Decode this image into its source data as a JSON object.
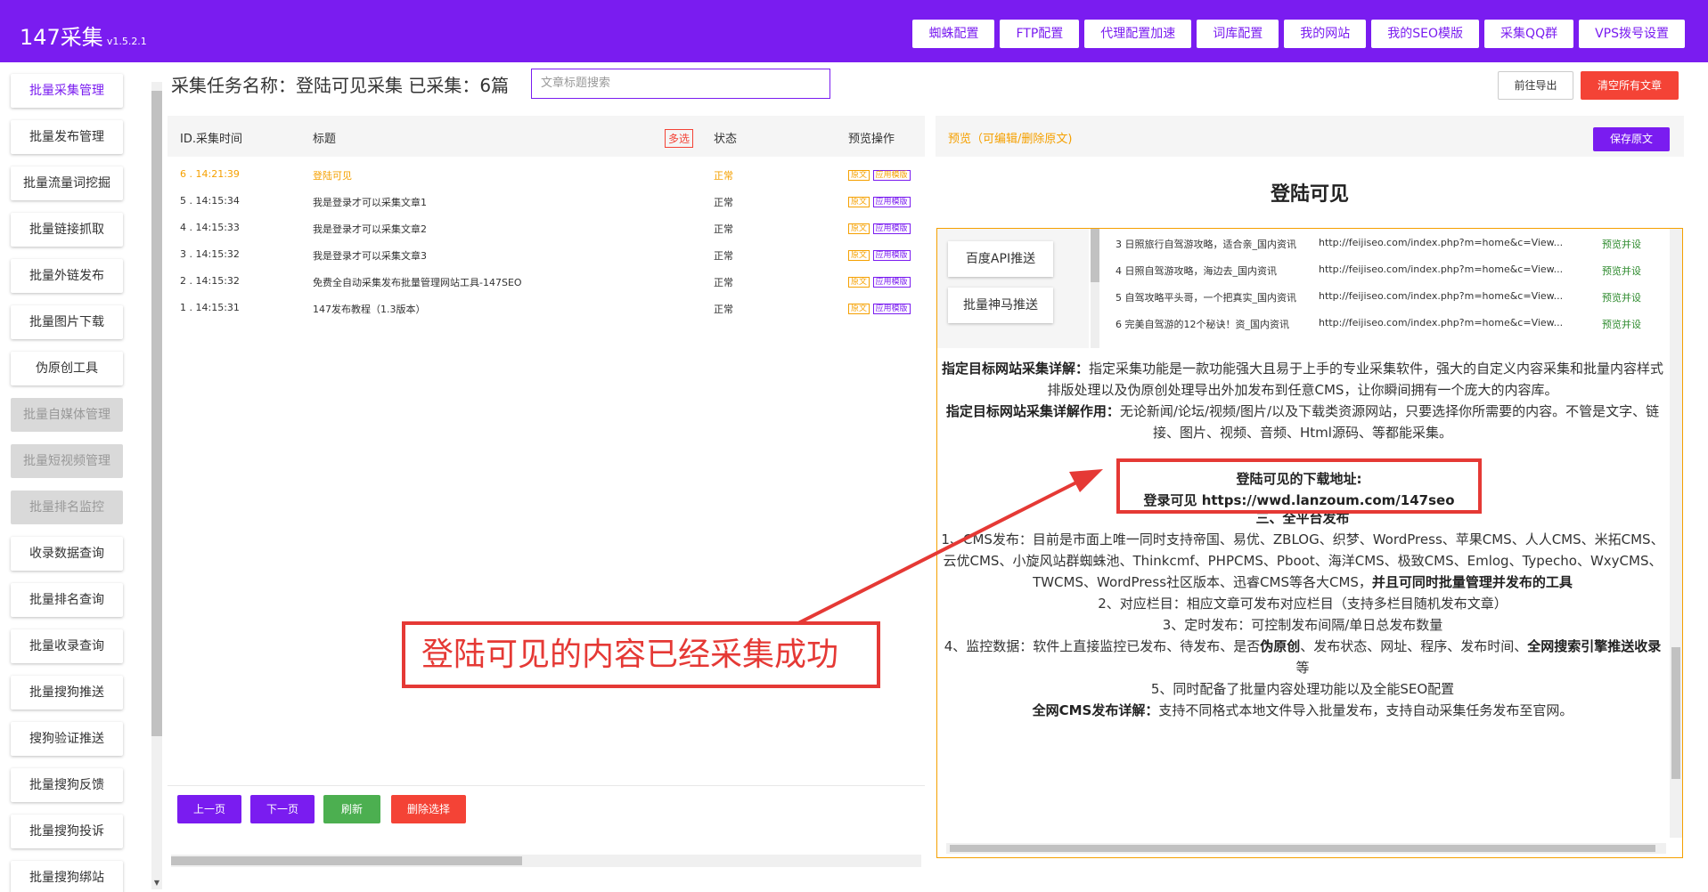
{
  "app": {
    "name": "147采集",
    "version": "v1.5.2.1"
  },
  "colors": {
    "brand": "#7a1cf0",
    "danger": "#f44336",
    "warn": "#f5a000",
    "success": "#4caf50",
    "annotation": "#e53935"
  },
  "topnav": [
    "蜘蛛配置",
    "FTP配置",
    "代理配置加速",
    "词库配置",
    "我的网站",
    "我的SEO模版",
    "采集QQ群",
    "VPS拨号设置"
  ],
  "sidebar": {
    "items": [
      {
        "label": "批量采集管理",
        "state": "active"
      },
      {
        "label": "批量发布管理",
        "state": "normal"
      },
      {
        "label": "批量流量词挖掘",
        "state": "normal"
      },
      {
        "label": "批量链接抓取",
        "state": "normal"
      },
      {
        "label": "批量外链发布",
        "state": "normal"
      },
      {
        "label": "批量图片下载",
        "state": "normal"
      },
      {
        "label": "伪原创工具",
        "state": "normal"
      },
      {
        "label": "批量自媒体管理",
        "state": "disabled"
      },
      {
        "label": "批量短视频管理",
        "state": "disabled"
      },
      {
        "label": "批量排名监控",
        "state": "disabled"
      },
      {
        "label": "收录数据查询",
        "state": "normal"
      },
      {
        "label": "批量排名查询",
        "state": "normal"
      },
      {
        "label": "批量收录查询",
        "state": "normal"
      },
      {
        "label": "批量搜狗推送",
        "state": "normal"
      },
      {
        "label": "搜狗验证推送",
        "state": "normal"
      },
      {
        "label": "批量搜狗反馈",
        "state": "normal"
      },
      {
        "label": "批量搜狗投诉",
        "state": "normal"
      },
      {
        "label": "批量搜狗绑站",
        "state": "normal"
      }
    ]
  },
  "task": {
    "title": "采集任务名称：登陆可见采集 已采集：6篇",
    "search_placeholder": "文章标题搜索",
    "export_label": "前往导出",
    "clear_label": "清空所有文章"
  },
  "list": {
    "headers": {
      "id_time": "ID.采集时间",
      "title": "标题",
      "multi": "多选",
      "status": "状态",
      "actions": "预览操作"
    },
    "rows": [
      {
        "id_time": "6 . 14:21:39",
        "title": "登陆可见",
        "status": "正常",
        "tag1": "原文",
        "tag2": "应用模版",
        "highlight": true
      },
      {
        "id_time": "5 . 14:15:34",
        "title": "我是登录才可以采集文章1",
        "status": "正常",
        "tag1": "原文",
        "tag2": "应用模版",
        "highlight": false
      },
      {
        "id_time": "4 . 14:15:33",
        "title": "我是登录才可以采集文章2",
        "status": "正常",
        "tag1": "原文",
        "tag2": "应用模版",
        "highlight": false
      },
      {
        "id_time": "3 . 14:15:32",
        "title": "我是登录才可以采集文章3",
        "status": "正常",
        "tag1": "原文",
        "tag2": "应用模版",
        "highlight": false
      },
      {
        "id_time": "2 . 14:15:32",
        "title": "免费全自动采集发布批量管理网站工具-147SEO",
        "status": "正常",
        "tag1": "原文",
        "tag2": "应用模版",
        "highlight": false
      },
      {
        "id_time": "1 . 14:15:31",
        "title": "147发布教程（1.3版本）",
        "status": "正常",
        "tag1": "原文",
        "tag2": "应用模版",
        "highlight": false
      }
    ],
    "buttons": {
      "prev": "上一页",
      "next": "下一页",
      "refresh": "刷新",
      "delete": "删除选择"
    }
  },
  "preview": {
    "label": "预览（可编辑/删除原文)",
    "save_label": "保存原文",
    "title": "登陆可见",
    "embed": {
      "side_buttons": [
        "百度API推送",
        "批量神马推送"
      ],
      "rows": [
        {
          "title": "3 日照旅行自驾游攻略，适合亲_国内资讯",
          "url": "http://feijiseo.com/index.php?m=home&c=View...",
          "action": "预览并设"
        },
        {
          "title": "4 日照自驾游攻略，海边去_国内资讯",
          "url": "http://feijiseo.com/index.php?m=home&c=View...",
          "action": "预览并设"
        },
        {
          "title": "5 自驾攻略平头哥，一个把真实_国内资讯",
          "url": "http://feijiseo.com/index.php?m=home&c=View...",
          "action": "预览并设"
        },
        {
          "title": "6 完美自驾游的12个秘诀！资_国内资讯",
          "url": "http://feijiseo.com/index.php?m=home&c=View...",
          "action": "预览并设"
        }
      ]
    },
    "content": {
      "p1_bold": "指定目标网站采集详解：",
      "p1": "指定采集功能是一款功能强大且易于上手的专业采集软件，强大的自定义内容采集和批量内容样式排版处理以及伪原创处理导出外加发布到任意CMS，让你瞬间拥有一个庞大的内容库。",
      "p2_bold": "指定目标网站采集详解作用：",
      "p2": "无论新闻/论坛/视频/图片/以及下载类资源网站，只要选择你所需要的内容。不管是文字、链接、图片、视频、音频、Html源码、等都能采集。",
      "heading": "三、全平台发布",
      "p3": "1、CMS发布：目前是市面上唯一同时支持帝国、易优、ZBLOG、织梦、WordPress、苹果CMS、人人CMS、米拓CMS、云优CMS、小旋风站群蜘蛛池、Thinkcmf、PHPCMS、Pboot、海洋CMS、极致CMS、Emlog、Typecho、WxyCMS、TWCMS、WordPress社区版本、迅睿CMS等各大CMS，",
      "p3_bold": "并且可同时批量管理并发布的工具",
      "p4": "2、对应栏目：相应文章可发布对应栏目（支持多栏目随机发布文章）",
      "p5": "3、定时发布：可控制发布间隔/单日总发布数量",
      "p6a": "4、监控数据：软件上直接监控已发布、待发布、是否",
      "p6b": "伪原创",
      "p6c": "、发布状态、网址、程序、发布时间、",
      "p6d": "全网搜索引擎推送收录",
      "p6e": "等",
      "p7": "5、同时配备了批量内容处理功能以及全能SEO配置",
      "p8_bold": "全网CMS发布详解：",
      "p8": "支持不同格式本地文件导入批量发布，支持自动采集任务发布至官网。"
    },
    "download_box": {
      "line1": "登陆可见的下载地址:",
      "line2": "登录可见 https://wwd.lanzoum.com/147seo"
    }
  },
  "annotation": {
    "text": "登陆可见的内容已经采集成功"
  }
}
